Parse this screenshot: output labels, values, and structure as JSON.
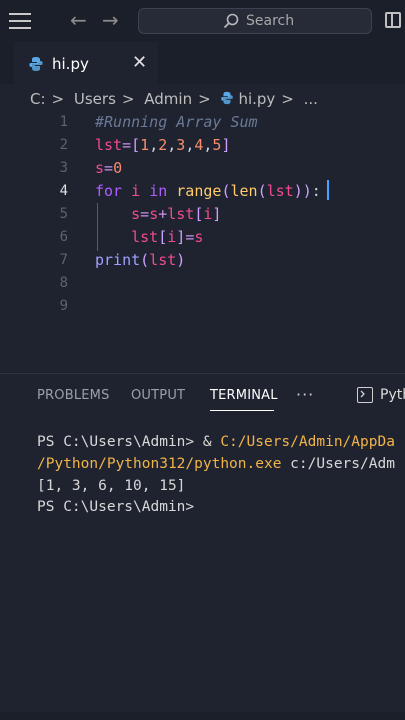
{
  "titlebar": {
    "search_placeholder": "Search",
    "back_icon": "arrow-left-icon",
    "forward_icon": "arrow-right-icon"
  },
  "tab": {
    "filename": "hi.py",
    "close_glyph": "✕"
  },
  "breadcrumb": {
    "parts": [
      "C:",
      "Users",
      "Admin",
      "hi.py",
      "..."
    ],
    "separator": ">"
  },
  "editor": {
    "line_numbers": [
      "1",
      "2",
      "3",
      "4",
      "5",
      "6",
      "7",
      "8",
      "9"
    ],
    "active_line": 4,
    "lines": [
      "#Running Array Sum",
      "lst=[1,2,3,4,5]",
      "s=0",
      "for i in range(len(lst)):",
      "    s=s+lst[i]",
      "    lst[i]=s",
      "print(lst)",
      "",
      ""
    ]
  },
  "panel": {
    "tabs": [
      "PROBLEMS",
      "OUTPUT",
      "TERMINAL"
    ],
    "active_tab": "TERMINAL",
    "more": "···",
    "terminal_label": "Pyth"
  },
  "terminal": {
    "line1_prompt": "PS C:\\Users\\Admin> & ",
    "line1_path": "C:/Users/Admin/AppDa",
    "line2_path": "/Python/Python312/python.exe",
    "line2_rest": " c:/Users/Adm",
    "line3": "[1, 3, 6, 10, 15]",
    "line4": "PS C:\\Users\\Admin>"
  },
  "colors": {
    "background": "#1f2330",
    "accent": "#4aa3ff",
    "terminal_path": "#f0b449"
  }
}
